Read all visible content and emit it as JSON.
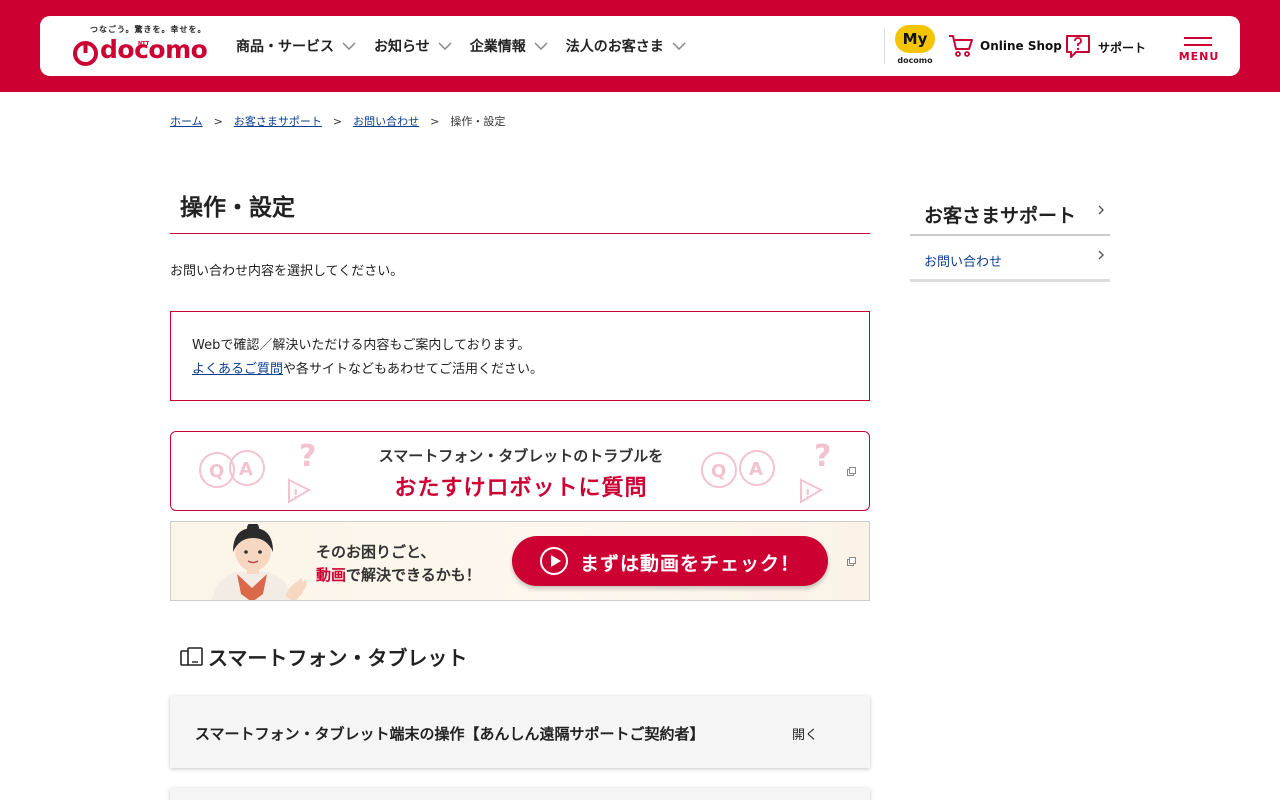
{
  "header": {
    "logo_tagline": "つなごう。驚きを。幸せを。",
    "logo_ntt": "NTT",
    "logo_text": "docomo",
    "nav": [
      {
        "label": "商品・サービス"
      },
      {
        "label": "お知らせ"
      },
      {
        "label": "企業情報"
      },
      {
        "label": "法人のお客さま"
      }
    ],
    "my_docomo": {
      "badge": "My",
      "sub": "docomo"
    },
    "online_shop": "Online Shop",
    "support": "サポート",
    "menu": "MENU"
  },
  "breadcrumb": [
    {
      "label": "ホーム",
      "link": true
    },
    {
      "label": "お客さまサポート",
      "link": true
    },
    {
      "label": "お問い合わせ",
      "link": true
    },
    {
      "label": "操作・設定",
      "link": false
    }
  ],
  "breadcrumb_separator": ">",
  "main": {
    "title": "操作・設定",
    "lead": "お問い合わせ内容を選択してください。",
    "info": {
      "line1": "Webで確認／解決いただける内容もご案内しております。",
      "faq_link": "よくあるご質問",
      "line2_rest": "や各サイトなどもあわせてご活用ください。"
    },
    "robot_banner": {
      "line1": "スマートフォン・タブレットのトラブルを",
      "line2": "おたすけロボットに質問"
    },
    "video_banner": {
      "line1": "そのお困りごと、",
      "line2_highlight": "動画",
      "line2_rest": "で解決できるかも！",
      "cta": "まずは動画をチェック！"
    },
    "section_title": "スマートフォン・タブレット",
    "accordions": [
      {
        "title": "スマートフォン・タブレット端末の操作【あんしん遠隔サポートご契約者】",
        "toggle": "開く"
      },
      {
        "title": "",
        "toggle": ""
      }
    ]
  },
  "sidebar": {
    "title": "お客さまサポート",
    "items": [
      {
        "label": "お問い合わせ"
      }
    ]
  },
  "colors": {
    "brand": "#cc0033",
    "link": "#0b3d91",
    "my_docomo": "#f5c400"
  }
}
